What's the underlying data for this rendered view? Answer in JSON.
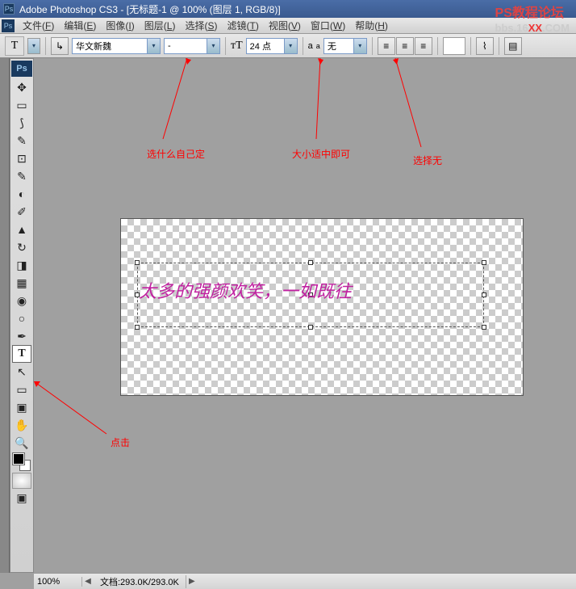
{
  "titlebar": {
    "title": "Adobe Photoshop CS3 - [无标题-1 @ 100% (图层 1, RGB/8)]"
  },
  "watermark": {
    "text1": "PS教程论坛",
    "text2": "bbs.16",
    "text3": "XX",
    "text4": ".COM"
  },
  "menu": {
    "items": [
      {
        "label": "文件",
        "key": "F"
      },
      {
        "label": "编辑",
        "key": "E"
      },
      {
        "label": "图像",
        "key": "I"
      },
      {
        "label": "图层",
        "key": "L"
      },
      {
        "label": "选择",
        "key": "S"
      },
      {
        "label": "滤镜",
        "key": "T"
      },
      {
        "label": "视图",
        "key": "V"
      },
      {
        "label": "窗口",
        "key": "W"
      },
      {
        "label": "帮助",
        "key": "H"
      }
    ]
  },
  "options": {
    "font_family": "华文新魏",
    "font_style": "-",
    "font_size": "24 点",
    "antialias_prefix": "a",
    "antialias": "无"
  },
  "annotations": {
    "font": "选什么自己定",
    "size": "大小适中即可",
    "aa": "选择无",
    "tool": "点击"
  },
  "canvas": {
    "text": "太多的强颜欢笑，一如既往"
  },
  "statusbar": {
    "zoom": "100%",
    "doc": "文档:293.0K/293.0K"
  }
}
